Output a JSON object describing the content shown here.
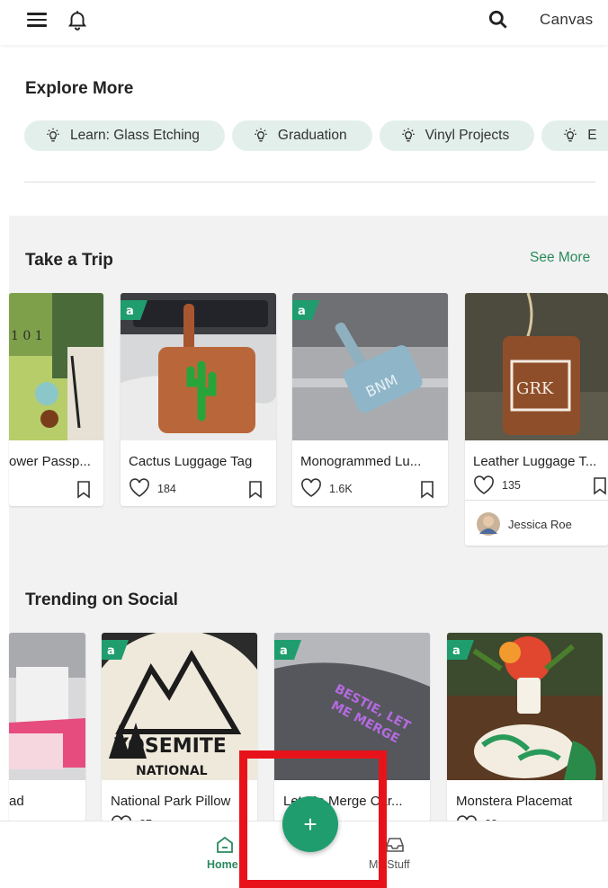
{
  "header": {
    "menu_icon": "hamburger-icon",
    "notification_icon": "bell-icon",
    "search_icon": "search-icon",
    "canvas_label": "Canvas"
  },
  "explore": {
    "title": "Explore More",
    "chips": [
      {
        "label": "Learn: Glass Etching",
        "icon": "lightbulb-icon"
      },
      {
        "label": "Graduation",
        "icon": "lightbulb-icon"
      },
      {
        "label": "Vinyl Projects",
        "icon": "lightbulb-icon"
      },
      {
        "label": "E",
        "icon": "lightbulb-icon"
      }
    ]
  },
  "take_a_trip": {
    "title": "Take a Trip",
    "see_more": "See More",
    "cards": [
      {
        "name": "ower Passp...",
        "likes": ""
      },
      {
        "name": "Cactus Luggage Tag",
        "likes": "184"
      },
      {
        "name": "Monogrammed Lu...",
        "likes": "1.6K"
      },
      {
        "name": "Leather Luggage T...",
        "likes": "135",
        "author": "Jessica Roe"
      }
    ]
  },
  "trending": {
    "title": "Trending on Social",
    "cards": [
      {
        "name": "ad"
      },
      {
        "name": "National Park Pillow",
        "likes": "27"
      },
      {
        "name": "Let Me Merge Car..."
      },
      {
        "name": "Monstera Placemat",
        "likes": "23"
      }
    ]
  },
  "bottom_nav": {
    "home_label": "Home",
    "stuff_label": "My Stuff",
    "fab_label": "+"
  },
  "colors": {
    "accent": "#1f9d6e",
    "chip_bg": "#e3efea",
    "highlight": "#e8131a"
  }
}
